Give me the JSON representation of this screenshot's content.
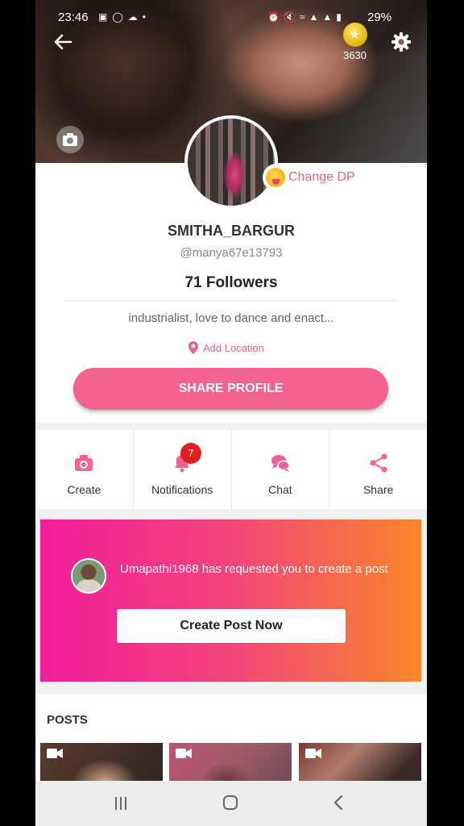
{
  "status_bar": {
    "time": "23:46",
    "left_icons": [
      "image-icon",
      "messenger-icon",
      "cloud-icon",
      "dot-icon"
    ],
    "right_icons": [
      "alarm-icon",
      "mute-icon",
      "wifi-icon",
      "volte-icon",
      "4g-icon",
      "signal-icon"
    ],
    "battery": "29%"
  },
  "header": {
    "coin_count": "3630"
  },
  "profile": {
    "username": "SMITHA_BARGUR",
    "handle": "@manya67e13793",
    "followers": "71 Followers",
    "bio": "industrialist, love to dance and enact...",
    "add_location": "Add Location",
    "change_dp": "Change DP",
    "share_button": "SHARE PROFILE"
  },
  "actions": {
    "items": [
      {
        "label": "Create",
        "icon": "camera-icon"
      },
      {
        "label": "Notifications",
        "icon": "bell-icon"
      },
      {
        "label": "Chat",
        "icon": "chat-icon"
      },
      {
        "label": "Share",
        "icon": "share-icon"
      }
    ],
    "notification_badge": "7"
  },
  "request": {
    "text": "Umapathi1968 has requested you to create a post",
    "button": "Create Post Now"
  },
  "posts": {
    "title": "POSTS"
  },
  "colors": {
    "accent_pink": "#f4628f",
    "banner_start": "#f21d9a",
    "banner_end": "#f9862a",
    "badge_red": "#e02020"
  }
}
